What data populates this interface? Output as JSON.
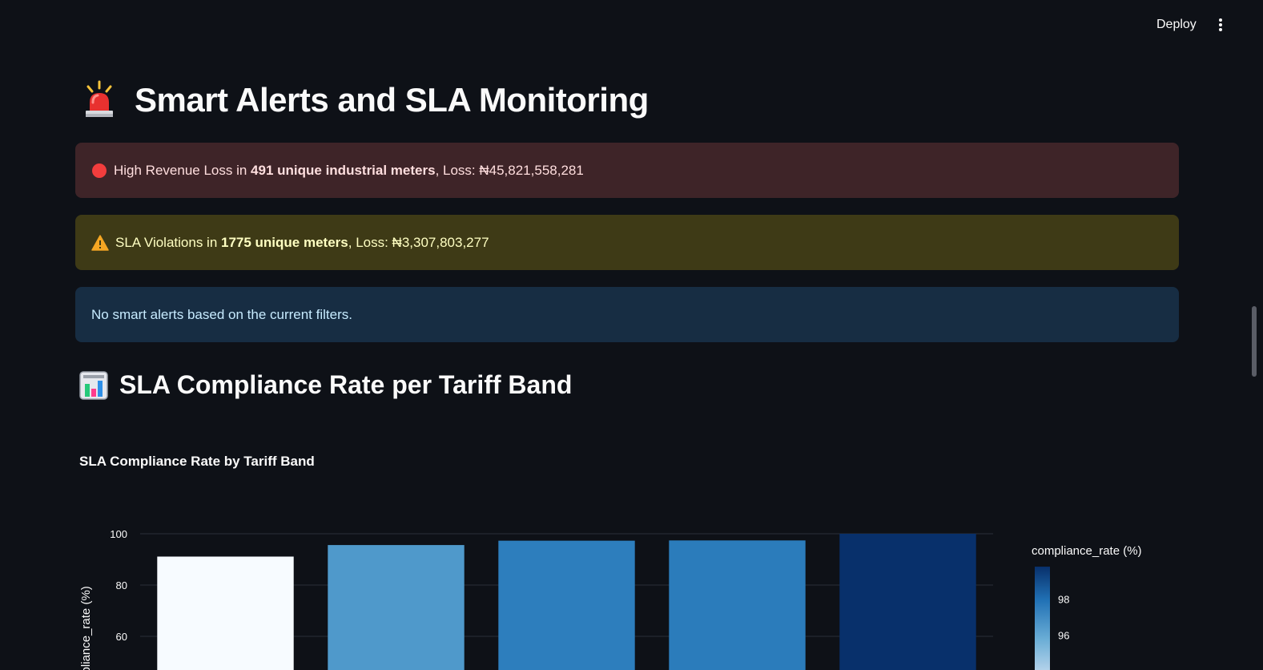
{
  "toolbar": {
    "deploy_label": "Deploy",
    "menu_icon": "vertical-ellipsis-icon"
  },
  "page": {
    "title": "Smart Alerts and SLA Monitoring",
    "title_icon": "police-light-icon"
  },
  "alerts": {
    "error": {
      "icon": "red-circle-icon",
      "prefix": "High Revenue Loss in ",
      "bold": "491 unique industrial meters",
      "suffix": ", Loss: ₦45,821,558,281"
    },
    "warning": {
      "icon": "warning-icon",
      "prefix": "SLA Violations in ",
      "bold": "1775 unique meters",
      "suffix": ", Loss: ₦3,307,803,277"
    },
    "info": {
      "text": "No smart alerts based on the current filters."
    }
  },
  "section": {
    "title": "SLA Compliance Rate per Tariff Band",
    "title_icon": "bar-chart-icon"
  },
  "colors": {
    "background": "#0e1117",
    "error_bg": "#3e2428",
    "warning_bg": "#3e3a16",
    "info_bg": "#172d43"
  },
  "chart_data": {
    "type": "bar",
    "title": "SLA Compliance Rate by Tariff Band",
    "xlabel": "",
    "ylabel": "compliance_rate (%)",
    "ylim": [
      0,
      100
    ],
    "yticks": [
      60,
      80,
      100
    ],
    "categories": [
      "",
      "",
      "",
      "",
      ""
    ],
    "values": [
      91.1,
      95.6,
      97.3,
      97.4,
      100
    ],
    "colorbar": {
      "title": "compliance_rate (%)",
      "ticks": [
        96,
        98
      ],
      "colorscale": "Blues",
      "range": [
        91.1,
        100
      ]
    },
    "grid": true
  }
}
